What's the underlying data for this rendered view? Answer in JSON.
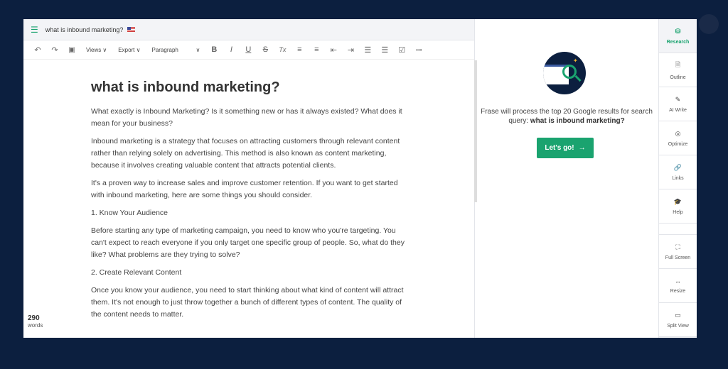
{
  "title_bar": {
    "doc_title": "what is inbound marketing?"
  },
  "toolbar": {
    "undo": "↶",
    "redo": "↷",
    "save": "💾",
    "views": "Views ∨",
    "export": "Export ∨",
    "paragraph": "Paragraph",
    "paragraph_chevron": "∨",
    "bold": "B",
    "italic": "I",
    "underline": "U",
    "strike": "S",
    "clear": "Tx",
    "align_left": "≡",
    "align_center": "≡",
    "outdent": "⇤",
    "indent": "⇥",
    "bullets": "☰",
    "numbered": "☰",
    "checklist": "☑",
    "more": "•••"
  },
  "document": {
    "heading": "what is inbound marketing?",
    "paragraphs": [
      "What exactly is Inbound Marketing? Is it something new or has it always existed? What does it mean for your business?",
      "Inbound marketing is a strategy that focuses on attracting customers through relevant content rather than relying solely on advertising. This method is also known as content marketing, because it involves creating valuable content that attracts potential clients.",
      "It's a proven way to increase sales and improve customer retention. If you want to get started with inbound marketing, here are some things you should consider.",
      "1. Know Your Audience",
      "Before starting any type of marketing campaign, you need to know who you're targeting. You can't expect to reach everyone if you only target one specific group of people. So, what do they like? What problems are they trying to solve?",
      "2. Create Relevant Content",
      "Once you know your audience, you need to start thinking about what kind of content will attract them. It's not enough to just throw together a bunch of different types of content. The quality of the content needs to matter."
    ]
  },
  "word_count": {
    "value": "290",
    "label": "words"
  },
  "research_panel": {
    "text": "Frase will process the top 20 Google results for search query: ",
    "query": "what is inbound marketing?",
    "button": "Let's go!",
    "button_arrow": "→"
  },
  "sidebar": {
    "items": [
      {
        "label": "Research",
        "icon": "⛁"
      },
      {
        "label": "Outline",
        "icon": "🗎"
      },
      {
        "label": "AI Write",
        "icon": "✎"
      },
      {
        "label": "Optimize",
        "icon": "◎"
      },
      {
        "label": "Links",
        "icon": "🔗"
      },
      {
        "label": "Help",
        "icon": "🎓"
      },
      {
        "label": "Full Screen",
        "icon": "⛶"
      },
      {
        "label": "Resize",
        "icon": "↔"
      },
      {
        "label": "Split View",
        "icon": "▭"
      }
    ]
  },
  "colors": {
    "accent": "#1aa36f",
    "background": "#0c1f3f"
  }
}
